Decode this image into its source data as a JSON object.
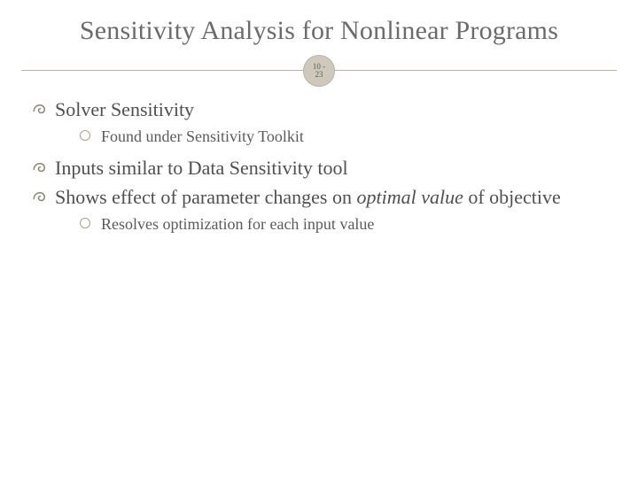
{
  "title": "Sensitivity Analysis for Nonlinear Programs",
  "badge": {
    "top": "10 -",
    "bottom": "23"
  },
  "bullets": [
    {
      "text": "Solver Sensitivity",
      "children": [
        {
          "text": "Found under Sensitivity Toolkit"
        }
      ]
    },
    {
      "text": "Inputs similar to Data Sensitivity tool",
      "children": []
    },
    {
      "text_pre": "Shows effect of parameter changes on ",
      "text_em": "optimal value",
      "text_post": " of objective",
      "children": [
        {
          "text": "Resolves optimization for each input value"
        }
      ]
    }
  ]
}
